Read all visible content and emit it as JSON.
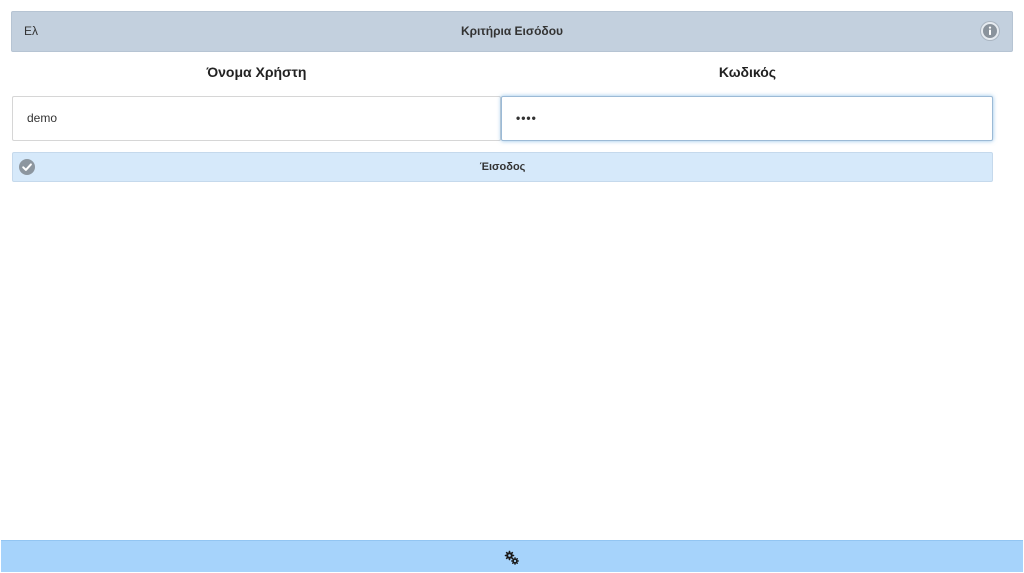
{
  "header": {
    "language": "Ελ",
    "title": "Κριτήρια Εισόδου",
    "info_icon": "info-icon"
  },
  "form": {
    "username_label": "Όνομα Χρήστη",
    "password_label": "Κωδικός",
    "username_value": "demo",
    "password_value": "••••"
  },
  "login_button": {
    "label": "Έισοδος",
    "icon": "check-icon"
  },
  "footer": {
    "icon": "gears-icon"
  },
  "colors": {
    "header_bg": "#c3d0de",
    "button_bg": "#d6e9fa",
    "footer_bg": "#a6d3fb",
    "icon_gray": "#8c969f"
  }
}
